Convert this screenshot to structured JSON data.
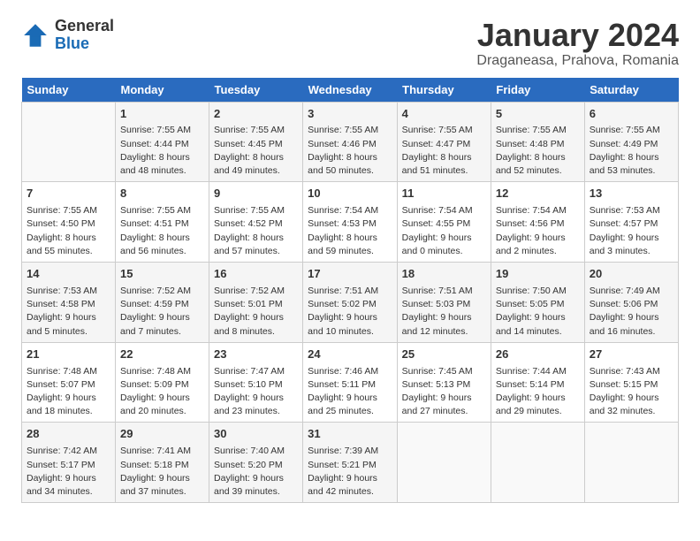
{
  "header": {
    "logo_general": "General",
    "logo_blue": "Blue",
    "month_title": "January 2024",
    "location": "Draganeasa, Prahova, Romania"
  },
  "days_of_week": [
    "Sunday",
    "Monday",
    "Tuesday",
    "Wednesday",
    "Thursday",
    "Friday",
    "Saturday"
  ],
  "weeks": [
    [
      {
        "day": "",
        "info": ""
      },
      {
        "day": "1",
        "info": "Sunrise: 7:55 AM\nSunset: 4:44 PM\nDaylight: 8 hours\nand 48 minutes."
      },
      {
        "day": "2",
        "info": "Sunrise: 7:55 AM\nSunset: 4:45 PM\nDaylight: 8 hours\nand 49 minutes."
      },
      {
        "day": "3",
        "info": "Sunrise: 7:55 AM\nSunset: 4:46 PM\nDaylight: 8 hours\nand 50 minutes."
      },
      {
        "day": "4",
        "info": "Sunrise: 7:55 AM\nSunset: 4:47 PM\nDaylight: 8 hours\nand 51 minutes."
      },
      {
        "day": "5",
        "info": "Sunrise: 7:55 AM\nSunset: 4:48 PM\nDaylight: 8 hours\nand 52 minutes."
      },
      {
        "day": "6",
        "info": "Sunrise: 7:55 AM\nSunset: 4:49 PM\nDaylight: 8 hours\nand 53 minutes."
      }
    ],
    [
      {
        "day": "7",
        "info": "Sunrise: 7:55 AM\nSunset: 4:50 PM\nDaylight: 8 hours\nand 55 minutes."
      },
      {
        "day": "8",
        "info": "Sunrise: 7:55 AM\nSunset: 4:51 PM\nDaylight: 8 hours\nand 56 minutes."
      },
      {
        "day": "9",
        "info": "Sunrise: 7:55 AM\nSunset: 4:52 PM\nDaylight: 8 hours\nand 57 minutes."
      },
      {
        "day": "10",
        "info": "Sunrise: 7:54 AM\nSunset: 4:53 PM\nDaylight: 8 hours\nand 59 minutes."
      },
      {
        "day": "11",
        "info": "Sunrise: 7:54 AM\nSunset: 4:55 PM\nDaylight: 9 hours\nand 0 minutes."
      },
      {
        "day": "12",
        "info": "Sunrise: 7:54 AM\nSunset: 4:56 PM\nDaylight: 9 hours\nand 2 minutes."
      },
      {
        "day": "13",
        "info": "Sunrise: 7:53 AM\nSunset: 4:57 PM\nDaylight: 9 hours\nand 3 minutes."
      }
    ],
    [
      {
        "day": "14",
        "info": "Sunrise: 7:53 AM\nSunset: 4:58 PM\nDaylight: 9 hours\nand 5 minutes."
      },
      {
        "day": "15",
        "info": "Sunrise: 7:52 AM\nSunset: 4:59 PM\nDaylight: 9 hours\nand 7 minutes."
      },
      {
        "day": "16",
        "info": "Sunrise: 7:52 AM\nSunset: 5:01 PM\nDaylight: 9 hours\nand 8 minutes."
      },
      {
        "day": "17",
        "info": "Sunrise: 7:51 AM\nSunset: 5:02 PM\nDaylight: 9 hours\nand 10 minutes."
      },
      {
        "day": "18",
        "info": "Sunrise: 7:51 AM\nSunset: 5:03 PM\nDaylight: 9 hours\nand 12 minutes."
      },
      {
        "day": "19",
        "info": "Sunrise: 7:50 AM\nSunset: 5:05 PM\nDaylight: 9 hours\nand 14 minutes."
      },
      {
        "day": "20",
        "info": "Sunrise: 7:49 AM\nSunset: 5:06 PM\nDaylight: 9 hours\nand 16 minutes."
      }
    ],
    [
      {
        "day": "21",
        "info": "Sunrise: 7:48 AM\nSunset: 5:07 PM\nDaylight: 9 hours\nand 18 minutes."
      },
      {
        "day": "22",
        "info": "Sunrise: 7:48 AM\nSunset: 5:09 PM\nDaylight: 9 hours\nand 20 minutes."
      },
      {
        "day": "23",
        "info": "Sunrise: 7:47 AM\nSunset: 5:10 PM\nDaylight: 9 hours\nand 23 minutes."
      },
      {
        "day": "24",
        "info": "Sunrise: 7:46 AM\nSunset: 5:11 PM\nDaylight: 9 hours\nand 25 minutes."
      },
      {
        "day": "25",
        "info": "Sunrise: 7:45 AM\nSunset: 5:13 PM\nDaylight: 9 hours\nand 27 minutes."
      },
      {
        "day": "26",
        "info": "Sunrise: 7:44 AM\nSunset: 5:14 PM\nDaylight: 9 hours\nand 29 minutes."
      },
      {
        "day": "27",
        "info": "Sunrise: 7:43 AM\nSunset: 5:15 PM\nDaylight: 9 hours\nand 32 minutes."
      }
    ],
    [
      {
        "day": "28",
        "info": "Sunrise: 7:42 AM\nSunset: 5:17 PM\nDaylight: 9 hours\nand 34 minutes."
      },
      {
        "day": "29",
        "info": "Sunrise: 7:41 AM\nSunset: 5:18 PM\nDaylight: 9 hours\nand 37 minutes."
      },
      {
        "day": "30",
        "info": "Sunrise: 7:40 AM\nSunset: 5:20 PM\nDaylight: 9 hours\nand 39 minutes."
      },
      {
        "day": "31",
        "info": "Sunrise: 7:39 AM\nSunset: 5:21 PM\nDaylight: 9 hours\nand 42 minutes."
      },
      {
        "day": "",
        "info": ""
      },
      {
        "day": "",
        "info": ""
      },
      {
        "day": "",
        "info": ""
      }
    ]
  ]
}
